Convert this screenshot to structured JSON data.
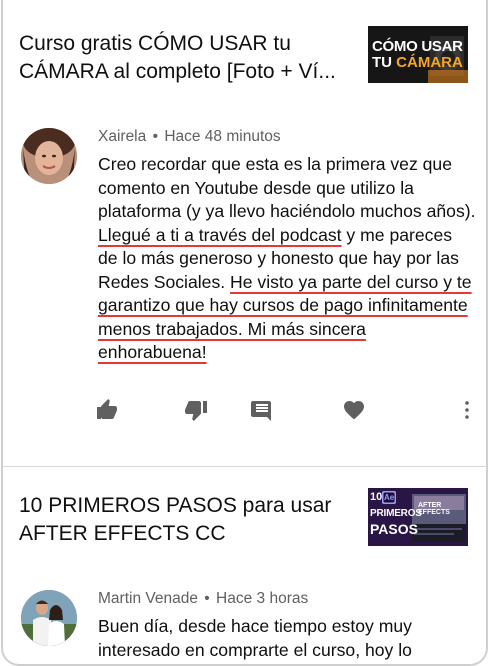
{
  "video1": {
    "title": "Curso gratis CÓMO USAR tu CÁMARA al completo [Foto + Ví...",
    "thumb_line1": "CÓMO USAR",
    "thumb_line2_a": "TU ",
    "thumb_line2_b": "CÁMARA"
  },
  "comment1": {
    "author": "Xairela",
    "separator": "•",
    "time": "Hace 48 minutos",
    "text_plain_1": "Creo recordar que esta es la primera vez que comento en Youtube desde que utilizo la plataforma (y ya llevo haciéndolo muchos años). ",
    "text_hl_1": "Llegué a ti a través del podcast",
    "text_plain_2": " y me pareces de lo más generoso y honesto que hay por las Redes Sociales. ",
    "text_hl_2": "He visto ya parte del curso y te garantizo que hay cursos de pago infinitamente menos trabajados. Mi más sincera enhorabuena!",
    "actions": [
      "thumb-up-icon",
      "thumb-down-icon",
      "reply-icon",
      "heart-icon",
      "more-vert-icon"
    ]
  },
  "video2": {
    "title": "10 PRIMEROS PASOS para usar AFTER EFFECTS CC",
    "thumb_num": "10",
    "thumb_ae": "Ae",
    "thumb_line1": "PRIMEROS",
    "thumb_line2": "PASOS",
    "thumb_banner": "AFTER EFFECTS"
  },
  "comment2": {
    "author": "Martin Venade",
    "separator": "•",
    "time": "Hace 3 horas",
    "text": "Buen día, desde hace tiempo estoy muy interesado en comprarte el curso, hoy lo"
  },
  "colors": {
    "underline": "#e53935",
    "meta_text": "#606060",
    "icon": "#606060",
    "thumb2_bg": "#2a1646",
    "ae_purple": "#9999ff"
  }
}
